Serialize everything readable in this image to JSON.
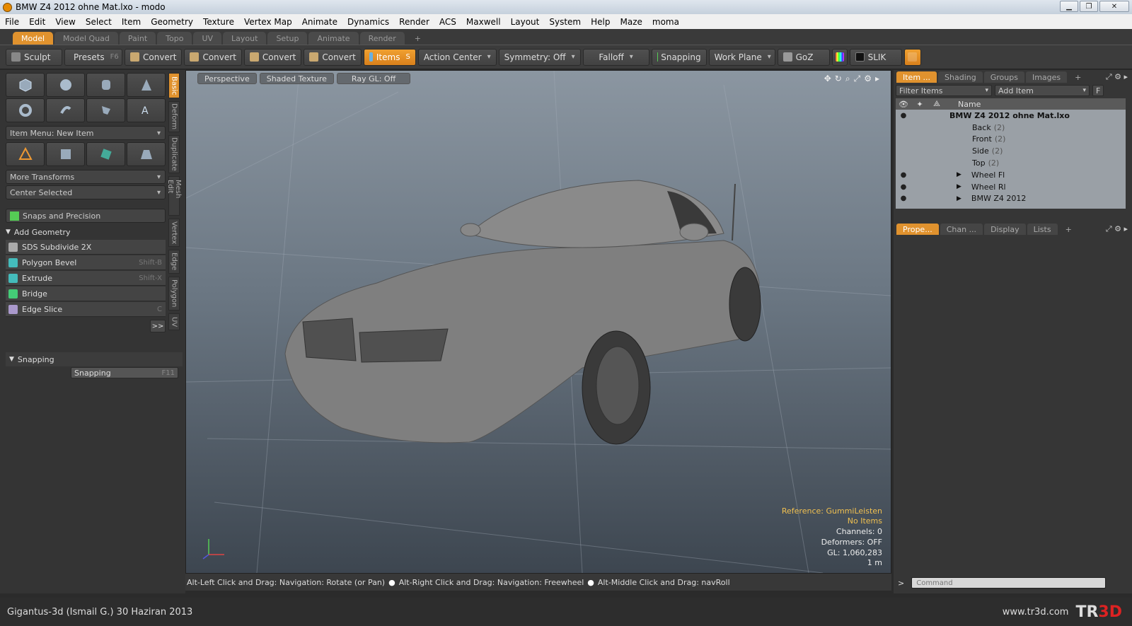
{
  "window": {
    "title": "BMW Z4 2012 ohne Mat.lxo - modo",
    "min": "▁",
    "max": "❐",
    "close": "✕"
  },
  "menu": [
    "File",
    "Edit",
    "View",
    "Select",
    "Item",
    "Geometry",
    "Texture",
    "Vertex Map",
    "Animate",
    "Dynamics",
    "Render",
    "ACS",
    "Maxwell",
    "Layout",
    "System",
    "Help",
    "Maze",
    "moma"
  ],
  "layout_tabs": [
    "Model",
    "Model Quad",
    "Paint",
    "Topo",
    "UV",
    "Layout",
    "Setup",
    "Animate",
    "Render",
    "+"
  ],
  "toolbar": {
    "sculpt": "Sculpt",
    "presets": "Presets",
    "presets_key": "F6",
    "convert": "Convert",
    "items": "Items",
    "items_key": "S",
    "action_center": "Action Center",
    "symmetry": "Symmetry: Off",
    "falloff": "Falloff",
    "snapping": "Snapping",
    "work_plane": "Work Plane",
    "goz": "GoZ",
    "slik": "SLIK"
  },
  "left": {
    "item_menu": "Item Menu: New Item",
    "more_transforms": "More Transforms",
    "center_selected": "Center Selected",
    "snaps_precision": "Snaps and Precision",
    "add_geometry": "Add Geometry",
    "tools": [
      {
        "label": "SDS Subdivide 2X",
        "shortcut": ""
      },
      {
        "label": "Polygon Bevel",
        "shortcut": "Shift-B"
      },
      {
        "label": "Extrude",
        "shortcut": "Shift-X"
      },
      {
        "label": "Bridge",
        "shortcut": ""
      },
      {
        "label": "Edge Slice",
        "shortcut": "C"
      }
    ],
    "more": ">>",
    "snapping_header": "Snapping",
    "snapping_btn": "Snapping",
    "snapping_key": "F11",
    "vtabs": [
      "Basic",
      "Deform",
      "Duplicate",
      "Mesh Edit",
      "Vertex",
      "Edge",
      "Polygon",
      "UV"
    ]
  },
  "viewport": {
    "view": "Perspective",
    "shading": "Shaded Texture",
    "raygl": "Ray GL: Off",
    "reference": "Reference: GummiLeisten",
    "no_items": "No Items",
    "channels": "Channels: 0",
    "deformers": "Deformers: OFF",
    "gl": "GL: 1,060,283",
    "scale": "1 m"
  },
  "statusbar": {
    "hint1": "Alt-Left Click and Drag: Navigation: Rotate (or Pan)",
    "hint2": "Alt-Right Click and Drag: Navigation: Freewheel",
    "hint3": "Alt-Middle Click and Drag: navRoll"
  },
  "right": {
    "tabs_top": [
      "Item ...",
      "Shading",
      "Groups",
      "Images",
      "+"
    ],
    "filter": "Filter Items",
    "add_item": "Add Item",
    "f": "F",
    "col_name": "Name",
    "items": [
      {
        "name": "BMW Z4 2012 ohne Mat.lxo",
        "count": ""
      },
      {
        "name": "Back",
        "count": "(2)"
      },
      {
        "name": "Front",
        "count": "(2)"
      },
      {
        "name": "Side",
        "count": "(2)"
      },
      {
        "name": "Top",
        "count": "(2)"
      },
      {
        "name": "Wheel Fl",
        "count": ""
      },
      {
        "name": "Wheel Rl",
        "count": ""
      },
      {
        "name": "BMW Z4 2012",
        "count": ""
      }
    ],
    "tabs_bottom": [
      "Prope...",
      "Chan ...",
      "Display",
      "Lists",
      "+"
    ],
    "cmd_prompt": ">",
    "cmd_placeholder": "Command"
  },
  "footer": {
    "credit": "Gigantus-3d (Ismail G.)  30 Haziran 2013",
    "url": "www.tr3d.com",
    "logo_a": "TR",
    "logo_b": "3D"
  },
  "colors": {
    "accent": "#e0922e"
  }
}
